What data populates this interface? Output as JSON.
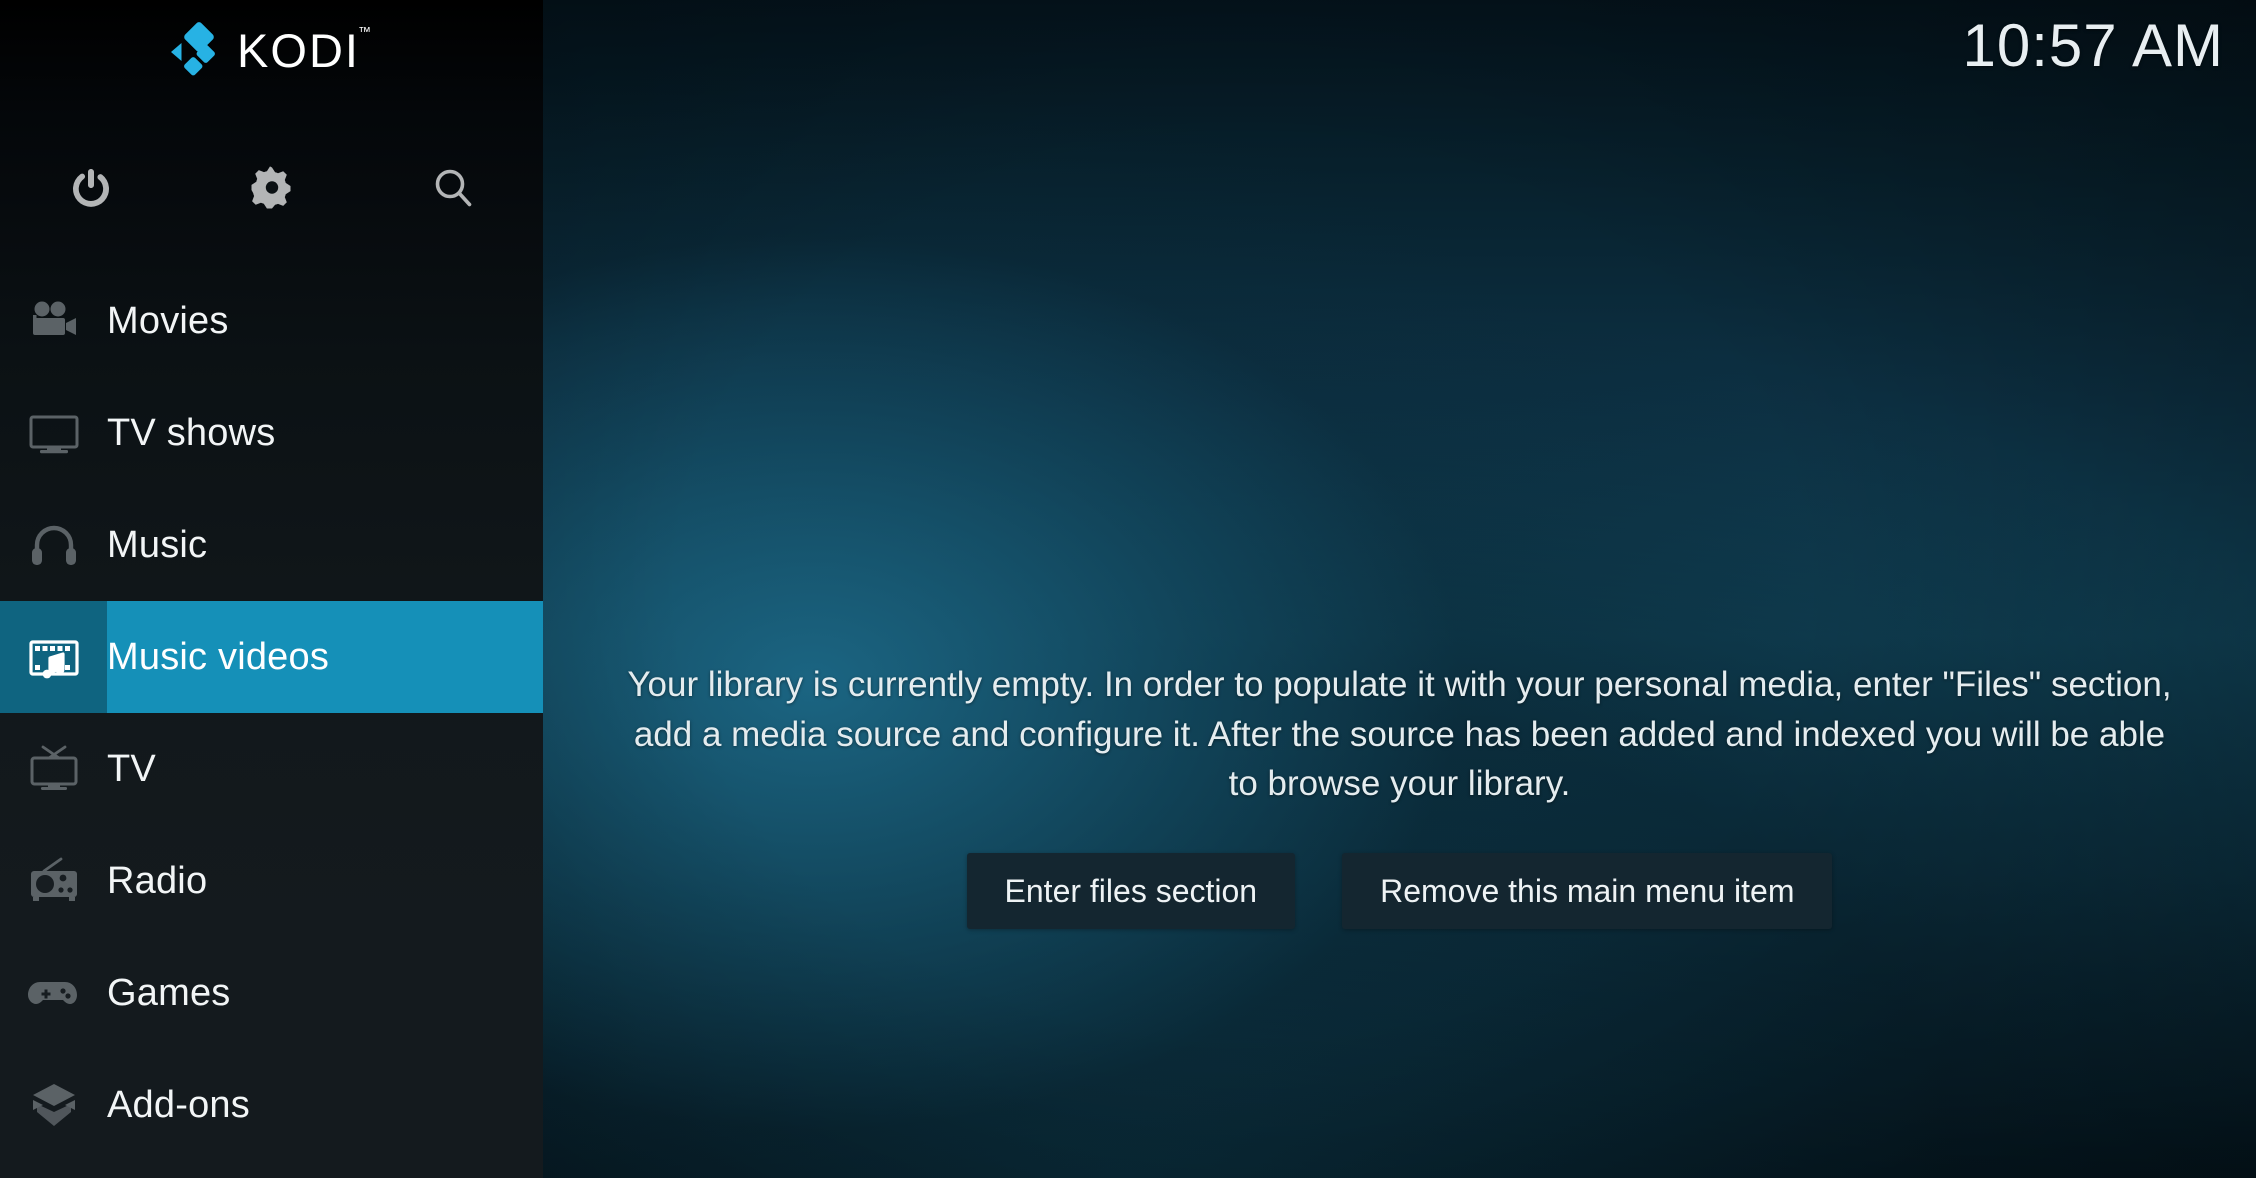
{
  "app": {
    "brand_name": "KODI",
    "brand_tm": "™",
    "logo_color": "#27b2e4",
    "accent_color": "#1590b8",
    "accent_dark_color": "#0f6480"
  },
  "header": {
    "clock": "10:57 AM"
  },
  "toolbar": {
    "buttons": [
      {
        "label": "Power",
        "icon": "power-icon"
      },
      {
        "label": "Settings",
        "icon": "gear-icon"
      },
      {
        "label": "Search",
        "icon": "search-icon"
      }
    ]
  },
  "sidebar": {
    "items": [
      {
        "label": "Movies",
        "icon": "movie-camera-icon",
        "selected": false
      },
      {
        "label": "TV shows",
        "icon": "monitor-icon",
        "selected": false
      },
      {
        "label": "Music",
        "icon": "headphones-icon",
        "selected": false
      },
      {
        "label": "Music videos",
        "icon": "film-music-icon",
        "selected": true
      },
      {
        "label": "TV",
        "icon": "retro-tv-icon",
        "selected": false
      },
      {
        "label": "Radio",
        "icon": "radio-icon",
        "selected": false
      },
      {
        "label": "Games",
        "icon": "gamepad-icon",
        "selected": false
      },
      {
        "label": "Add-ons",
        "icon": "open-box-icon",
        "selected": false
      }
    ]
  },
  "main": {
    "empty_message": "Your library is currently empty. In order to populate it with your personal media, enter \"Files\" section, add a media source and configure it. After the source has been added and indexed you will be able to browse your library.",
    "buttons": [
      {
        "label": "Enter files section"
      },
      {
        "label": "Remove this main menu item"
      }
    ]
  }
}
